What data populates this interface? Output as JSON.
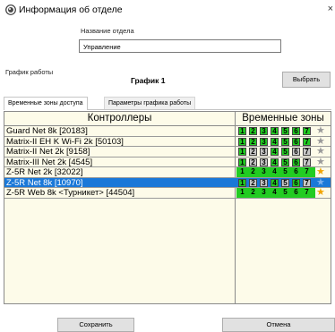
{
  "window": {
    "title": "Информация об отделе",
    "close_glyph": "×"
  },
  "department": {
    "label": "Название отдела",
    "value": "Управление"
  },
  "schedule": {
    "label": "График работы",
    "name": "График 1",
    "choose_label": "Выбрать"
  },
  "tabs": [
    {
      "label": "Временные зоны доступа",
      "active": true
    },
    {
      "label": "Параметры графика работы",
      "active": false
    }
  ],
  "table": {
    "headers": [
      "Контроллеры",
      "Временные зоны"
    ],
    "rows": [
      {
        "name": "Guard Net 8k [20183]",
        "style": "boxed",
        "zones_on": [
          1,
          2,
          3,
          4,
          5,
          6,
          7
        ],
        "star": "gray",
        "selected": false
      },
      {
        "name": "Matrix-II EH K Wi-Fi 2k  [50103]",
        "style": "boxed",
        "zones_on": [
          1,
          2,
          3,
          4,
          5,
          6,
          7
        ],
        "star": "gray",
        "selected": false
      },
      {
        "name": "Matrix-II Net 2k [9158]",
        "style": "boxed",
        "zones_on": [
          1,
          4,
          5
        ],
        "star": "gray",
        "selected": false
      },
      {
        "name": "Matrix-III Net 2k [4545]",
        "style": "boxed",
        "zones_on": [
          1,
          4,
          5,
          6
        ],
        "star": "gray",
        "selected": false
      },
      {
        "name": "Z-5R Net 2k [32022]",
        "style": "flat",
        "zones_on": [
          1,
          2,
          3,
          4,
          5,
          6,
          7
        ],
        "star": "orange",
        "selected": false
      },
      {
        "name": "Z-5R Net 8k [10970]",
        "style": "boxed",
        "zones_on": [
          1,
          4,
          6
        ],
        "star": "blue",
        "selected": true
      },
      {
        "name": "Z-5R Web 8k <Турникет> [44504]",
        "style": "flat",
        "zones_on": [
          1,
          2,
          3,
          4,
          5,
          6,
          7
        ],
        "star": "orange",
        "selected": false
      }
    ]
  },
  "buttons": {
    "save": "Сохранить",
    "cancel": "Отмена"
  },
  "colors": {
    "selected_row": "#1a78d8",
    "zone_on": "#22cc22",
    "zone_off": "#c8c8c8",
    "grid_bg": "#fdfbe9"
  },
  "icons": {
    "window": "info-window-icon",
    "star": "star-icon"
  }
}
